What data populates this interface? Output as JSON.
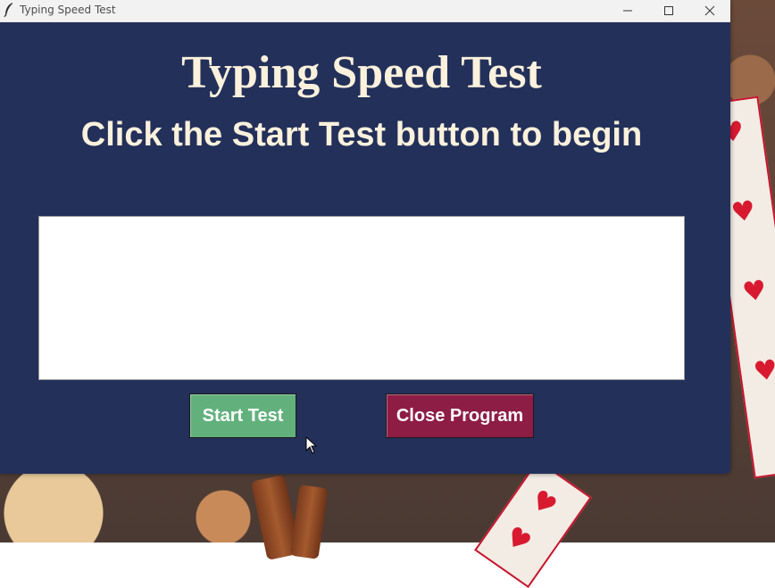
{
  "window": {
    "title": "Typing Speed Test",
    "controls": {
      "minimize": "minimize-icon",
      "maximize": "maximize-icon",
      "close": "close-icon"
    }
  },
  "main": {
    "heading": "Typing Speed Test",
    "instruction": "Click the Start Test button to begin",
    "typing_area": {
      "value": ""
    },
    "buttons": {
      "start_label": "Start Test",
      "close_label": "Close Program"
    }
  },
  "colors": {
    "window_background": "#23305a",
    "heading_text": "#fbf1dc",
    "start_button": "#62b17d",
    "close_button": "#8e1d45"
  }
}
